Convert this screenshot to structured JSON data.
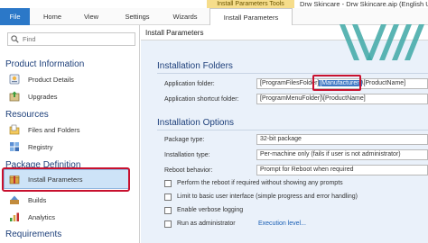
{
  "window_title": "Drw Skincare - Drw Skincare.aip (English US) - A",
  "context_tab_group": "Install Parameters Tools",
  "ribbon_tabs": [
    "File",
    "Home",
    "View",
    "Settings",
    "Wizards",
    "Install Parameters"
  ],
  "search": {
    "placeholder": "Find"
  },
  "sidebar": {
    "sections": [
      {
        "title": "Product Information",
        "items": [
          "Product Details",
          "Upgrades"
        ]
      },
      {
        "title": "Resources",
        "items": [
          "Files and Folders",
          "Registry"
        ]
      },
      {
        "title": "Package Definition",
        "items": [
          "Install Parameters",
          "Builds",
          "Analytics"
        ]
      },
      {
        "title": "Requirements",
        "items": []
      }
    ],
    "selected_item": "Install Parameters"
  },
  "main": {
    "title": "Install Parameters",
    "installation_folders": {
      "heading": "Installation Folders",
      "app_folder_label": "Application folder:",
      "app_folder_pre": "[ProgramFilesFolder]",
      "app_folder_token": "[Manufacturer]",
      "app_folder_post": "\\[ProductName]",
      "shortcut_label": "Application shortcut folder:",
      "shortcut_value": "[ProgramMenuFolder]\\[ProductName]"
    },
    "installation_options": {
      "heading": "Installation Options",
      "package_type_label": "Package type:",
      "package_type_value": "32-bit package",
      "installation_type_label": "Installation type:",
      "installation_type_value": "Per-machine only (fails if user is not administrator)",
      "reboot_label": "Reboot behavior:",
      "reboot_value": "Prompt for Reboot when required",
      "checkboxes": [
        "Perform the reboot if required without showing any prompts",
        "Limit to basic user interface (simple progress and error handling)",
        "Enable verbose logging",
        "Run as administrator"
      ],
      "execution_level_link": "Execution level..."
    }
  },
  "colors": {
    "file_tab": "#2b78c8",
    "selection": "#cde3f7",
    "annotation": "#c8102e",
    "heading": "#1d3f7a",
    "logo": "#3ea8a6"
  }
}
